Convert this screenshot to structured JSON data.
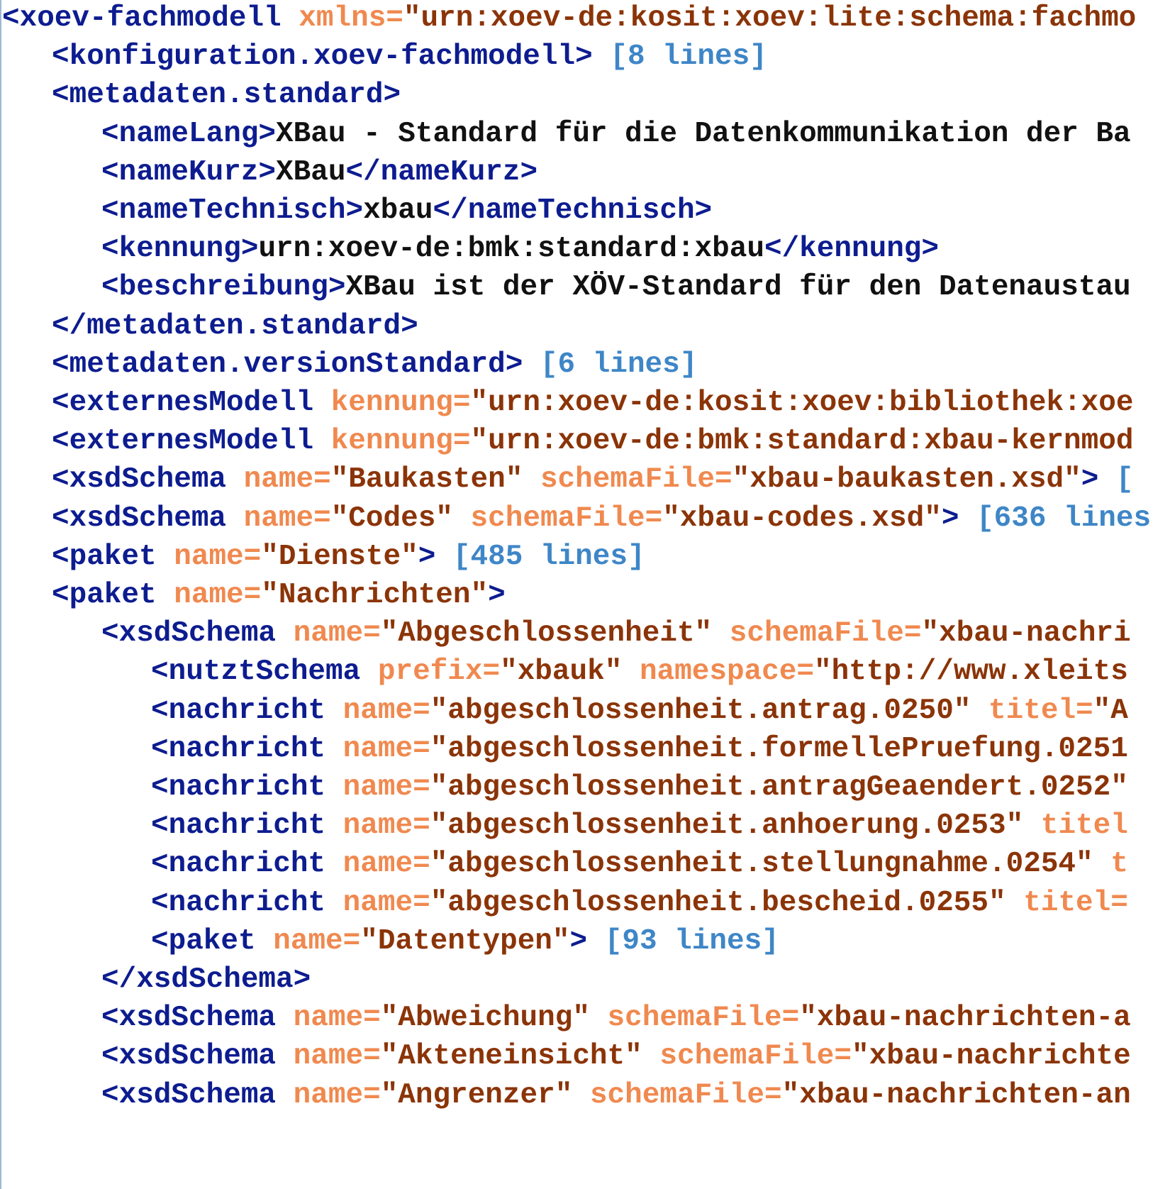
{
  "colors": {
    "tag": "#0d1c8f",
    "attribute": "#f0894f",
    "value": "#8b3408",
    "text": "#111111",
    "fold_marker": "#3e86c7",
    "gutter_border": "#9fb6d6"
  },
  "lines": [
    {
      "indent": 0,
      "tokens": [
        {
          "t": "tag",
          "v": "<xoev-fachmodell"
        },
        {
          "t": "text",
          "v": " "
        },
        {
          "t": "attr",
          "v": "xmlns="
        },
        {
          "t": "val",
          "v": "\"urn:xoev-de:kosit:xoev:lite:schema:fachmo"
        }
      ]
    },
    {
      "indent": 1,
      "tokens": [
        {
          "t": "tag",
          "v": "<konfiguration.xoev-fachmodell>"
        },
        {
          "t": "text",
          "v": " "
        },
        {
          "t": "fold",
          "v": "[8 lines]"
        }
      ]
    },
    {
      "indent": 1,
      "tokens": [
        {
          "t": "tag",
          "v": "<metadaten.standard>"
        }
      ]
    },
    {
      "indent": 2,
      "tokens": [
        {
          "t": "tag",
          "v": "<nameLang>"
        },
        {
          "t": "text",
          "v": "XBau - Standard für die Datenkommunikation der Ba"
        }
      ]
    },
    {
      "indent": 2,
      "tokens": [
        {
          "t": "tag",
          "v": "<nameKurz>"
        },
        {
          "t": "text",
          "v": "XBau"
        },
        {
          "t": "tag",
          "v": "</nameKurz>"
        }
      ]
    },
    {
      "indent": 2,
      "tokens": [
        {
          "t": "tag",
          "v": "<nameTechnisch>"
        },
        {
          "t": "text",
          "v": "xbau"
        },
        {
          "t": "tag",
          "v": "</nameTechnisch>"
        }
      ]
    },
    {
      "indent": 2,
      "tokens": [
        {
          "t": "tag",
          "v": "<kennung>"
        },
        {
          "t": "text",
          "v": "urn:xoev-de:bmk:standard:xbau"
        },
        {
          "t": "tag",
          "v": "</kennung>"
        }
      ]
    },
    {
      "indent": 2,
      "tokens": [
        {
          "t": "tag",
          "v": "<beschreibung>"
        },
        {
          "t": "text",
          "v": "XBau ist der XÖV-Standard für den Datenaustau"
        }
      ]
    },
    {
      "indent": 1,
      "tokens": [
        {
          "t": "tag",
          "v": "</metadaten.standard>"
        }
      ]
    },
    {
      "indent": 1,
      "tokens": [
        {
          "t": "tag",
          "v": "<metadaten.versionStandard>"
        },
        {
          "t": "text",
          "v": " "
        },
        {
          "t": "fold",
          "v": "[6 lines]"
        }
      ]
    },
    {
      "indent": 1,
      "tokens": [
        {
          "t": "tag",
          "v": "<externesModell"
        },
        {
          "t": "text",
          "v": " "
        },
        {
          "t": "attr",
          "v": "kennung="
        },
        {
          "t": "val",
          "v": "\"urn:xoev-de:kosit:xoev:bibliothek:xoe"
        }
      ]
    },
    {
      "indent": 1,
      "tokens": [
        {
          "t": "tag",
          "v": "<externesModell"
        },
        {
          "t": "text",
          "v": " "
        },
        {
          "t": "attr",
          "v": "kennung="
        },
        {
          "t": "val",
          "v": "\"urn:xoev-de:bmk:standard:xbau-kernmod"
        }
      ]
    },
    {
      "indent": 1,
      "tokens": [
        {
          "t": "tag",
          "v": "<xsdSchema"
        },
        {
          "t": "text",
          "v": " "
        },
        {
          "t": "attr",
          "v": "name="
        },
        {
          "t": "val",
          "v": "\"Baukasten\""
        },
        {
          "t": "text",
          "v": " "
        },
        {
          "t": "attr",
          "v": "schemaFile="
        },
        {
          "t": "val",
          "v": "\"xbau-baukasten.xsd\""
        },
        {
          "t": "tag",
          "v": ">"
        },
        {
          "t": "text",
          "v": " "
        },
        {
          "t": "fold",
          "v": "["
        }
      ]
    },
    {
      "indent": 1,
      "tokens": [
        {
          "t": "tag",
          "v": "<xsdSchema"
        },
        {
          "t": "text",
          "v": " "
        },
        {
          "t": "attr",
          "v": "name="
        },
        {
          "t": "val",
          "v": "\"Codes\""
        },
        {
          "t": "text",
          "v": " "
        },
        {
          "t": "attr",
          "v": "schemaFile="
        },
        {
          "t": "val",
          "v": "\"xbau-codes.xsd\""
        },
        {
          "t": "tag",
          "v": ">"
        },
        {
          "t": "text",
          "v": " "
        },
        {
          "t": "fold",
          "v": "[636 lines"
        }
      ]
    },
    {
      "indent": 1,
      "tokens": [
        {
          "t": "tag",
          "v": "<paket"
        },
        {
          "t": "text",
          "v": " "
        },
        {
          "t": "attr",
          "v": "name="
        },
        {
          "t": "val",
          "v": "\"Dienste\""
        },
        {
          "t": "tag",
          "v": ">"
        },
        {
          "t": "text",
          "v": " "
        },
        {
          "t": "fold",
          "v": "[485 lines]"
        }
      ]
    },
    {
      "indent": 1,
      "tokens": [
        {
          "t": "tag",
          "v": "<paket"
        },
        {
          "t": "text",
          "v": " "
        },
        {
          "t": "attr",
          "v": "name="
        },
        {
          "t": "val",
          "v": "\"Nachrichten\""
        },
        {
          "t": "tag",
          "v": ">"
        }
      ]
    },
    {
      "indent": 2,
      "tokens": [
        {
          "t": "tag",
          "v": "<xsdSchema"
        },
        {
          "t": "text",
          "v": " "
        },
        {
          "t": "attr",
          "v": "name="
        },
        {
          "t": "val",
          "v": "\"Abgeschlossenheit\""
        },
        {
          "t": "text",
          "v": " "
        },
        {
          "t": "attr",
          "v": "schemaFile="
        },
        {
          "t": "val",
          "v": "\"xbau-nachri"
        }
      ]
    },
    {
      "indent": 3,
      "tokens": [
        {
          "t": "tag",
          "v": "<nutztSchema"
        },
        {
          "t": "text",
          "v": " "
        },
        {
          "t": "attr",
          "v": "prefix="
        },
        {
          "t": "val",
          "v": "\"xbauk\""
        },
        {
          "t": "text",
          "v": " "
        },
        {
          "t": "attr",
          "v": "namespace="
        },
        {
          "t": "val",
          "v": "\"http://www.xleits"
        }
      ]
    },
    {
      "indent": 3,
      "tokens": [
        {
          "t": "tag",
          "v": "<nachricht"
        },
        {
          "t": "text",
          "v": " "
        },
        {
          "t": "attr",
          "v": "name="
        },
        {
          "t": "val",
          "v": "\"abgeschlossenheit.antrag.0250\""
        },
        {
          "t": "text",
          "v": " "
        },
        {
          "t": "attr",
          "v": "titel="
        },
        {
          "t": "val",
          "v": "\"A"
        }
      ]
    },
    {
      "indent": 3,
      "tokens": [
        {
          "t": "tag",
          "v": "<nachricht"
        },
        {
          "t": "text",
          "v": " "
        },
        {
          "t": "attr",
          "v": "name="
        },
        {
          "t": "val",
          "v": "\"abgeschlossenheit.formellePruefung.0251"
        }
      ]
    },
    {
      "indent": 3,
      "tokens": [
        {
          "t": "tag",
          "v": "<nachricht"
        },
        {
          "t": "text",
          "v": " "
        },
        {
          "t": "attr",
          "v": "name="
        },
        {
          "t": "val",
          "v": "\"abgeschlossenheit.antragGeaendert.0252\""
        }
      ]
    },
    {
      "indent": 3,
      "tokens": [
        {
          "t": "tag",
          "v": "<nachricht"
        },
        {
          "t": "text",
          "v": " "
        },
        {
          "t": "attr",
          "v": "name="
        },
        {
          "t": "val",
          "v": "\"abgeschlossenheit.anhoerung.0253\""
        },
        {
          "t": "text",
          "v": " "
        },
        {
          "t": "attr",
          "v": "titel"
        }
      ]
    },
    {
      "indent": 3,
      "tokens": [
        {
          "t": "tag",
          "v": "<nachricht"
        },
        {
          "t": "text",
          "v": " "
        },
        {
          "t": "attr",
          "v": "name="
        },
        {
          "t": "val",
          "v": "\"abgeschlossenheit.stellungnahme.0254\""
        },
        {
          "t": "text",
          "v": " "
        },
        {
          "t": "attr",
          "v": "t"
        }
      ]
    },
    {
      "indent": 3,
      "tokens": [
        {
          "t": "tag",
          "v": "<nachricht"
        },
        {
          "t": "text",
          "v": " "
        },
        {
          "t": "attr",
          "v": "name="
        },
        {
          "t": "val",
          "v": "\"abgeschlossenheit.bescheid.0255\""
        },
        {
          "t": "text",
          "v": " "
        },
        {
          "t": "attr",
          "v": "titel="
        }
      ]
    },
    {
      "indent": 3,
      "tokens": [
        {
          "t": "tag",
          "v": "<paket"
        },
        {
          "t": "text",
          "v": " "
        },
        {
          "t": "attr",
          "v": "name="
        },
        {
          "t": "val",
          "v": "\"Datentypen\""
        },
        {
          "t": "tag",
          "v": ">"
        },
        {
          "t": "text",
          "v": " "
        },
        {
          "t": "fold",
          "v": "[93 lines]"
        }
      ]
    },
    {
      "indent": 2,
      "tokens": [
        {
          "t": "tag",
          "v": "</xsdSchema>"
        }
      ]
    },
    {
      "indent": 2,
      "tokens": [
        {
          "t": "tag",
          "v": "<xsdSchema"
        },
        {
          "t": "text",
          "v": " "
        },
        {
          "t": "attr",
          "v": "name="
        },
        {
          "t": "val",
          "v": "\"Abweichung\""
        },
        {
          "t": "text",
          "v": " "
        },
        {
          "t": "attr",
          "v": "schemaFile="
        },
        {
          "t": "val",
          "v": "\"xbau-nachrichten-a"
        }
      ]
    },
    {
      "indent": 2,
      "tokens": [
        {
          "t": "tag",
          "v": "<xsdSchema"
        },
        {
          "t": "text",
          "v": " "
        },
        {
          "t": "attr",
          "v": "name="
        },
        {
          "t": "val",
          "v": "\"Akteneinsicht\""
        },
        {
          "t": "text",
          "v": " "
        },
        {
          "t": "attr",
          "v": "schemaFile="
        },
        {
          "t": "val",
          "v": "\"xbau-nachrichte"
        }
      ]
    },
    {
      "indent": 2,
      "tokens": [
        {
          "t": "tag",
          "v": "<xsdSchema"
        },
        {
          "t": "text",
          "v": " "
        },
        {
          "t": "attr",
          "v": "name="
        },
        {
          "t": "val",
          "v": "\"Angrenzer\""
        },
        {
          "t": "text",
          "v": " "
        },
        {
          "t": "attr",
          "v": "schemaFile="
        },
        {
          "t": "val",
          "v": "\"xbau-nachrichten-an"
        }
      ]
    }
  ]
}
